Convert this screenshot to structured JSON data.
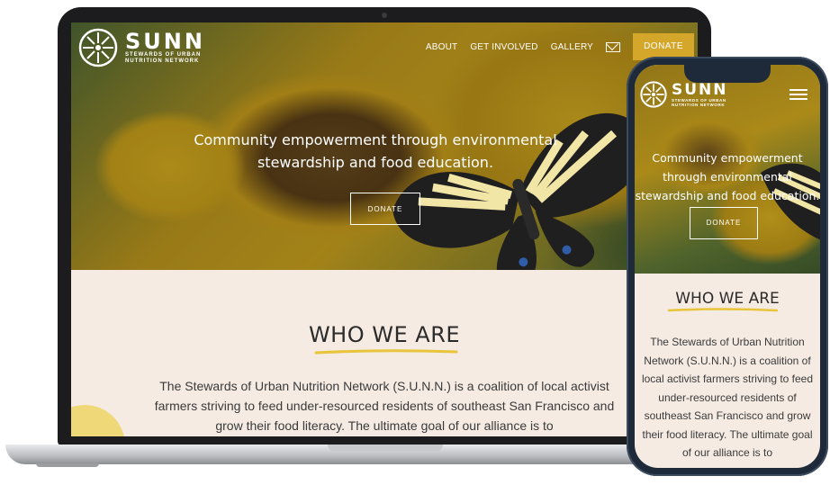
{
  "brand": {
    "name": "SUNN",
    "subtitle_line1": "STEWARDS OF URBAN",
    "subtitle_line2": "NUTRITION NETWORK"
  },
  "nav": {
    "about": "ABOUT",
    "get_involved": "GET INVOLVED",
    "gallery": "GALLERY",
    "donate": "DONATE"
  },
  "hero": {
    "tagline": "Community empowerment through environmental stewardship and food education.",
    "donate": "DONATE"
  },
  "who": {
    "title": "WHO WE ARE",
    "body_desktop": "The Stewards of Urban Nutrition Network (S.U.N.N.) is a coalition of local activist farmers striving to feed under-resourced residents of southeast San Francisco and grow their food literacy. The ultimate goal of our alliance is to",
    "body_mobile": "The Stewards of Urban Nutrition Network (S.U.N.N.) is a coalition of local activist farmers striving to feed under-resourced residents of southeast San Francisco and grow their food literacy. The ultimate goal of our alliance is to"
  },
  "colors": {
    "accent": "#d4a62a",
    "cream": "#f5ebe3",
    "underline": "#e8c43a",
    "text": "#2b2b2b"
  },
  "icons": {
    "mail": "mail-icon",
    "menu": "hamburger-menu-icon",
    "logo": "lemon-slice-logo-icon"
  }
}
